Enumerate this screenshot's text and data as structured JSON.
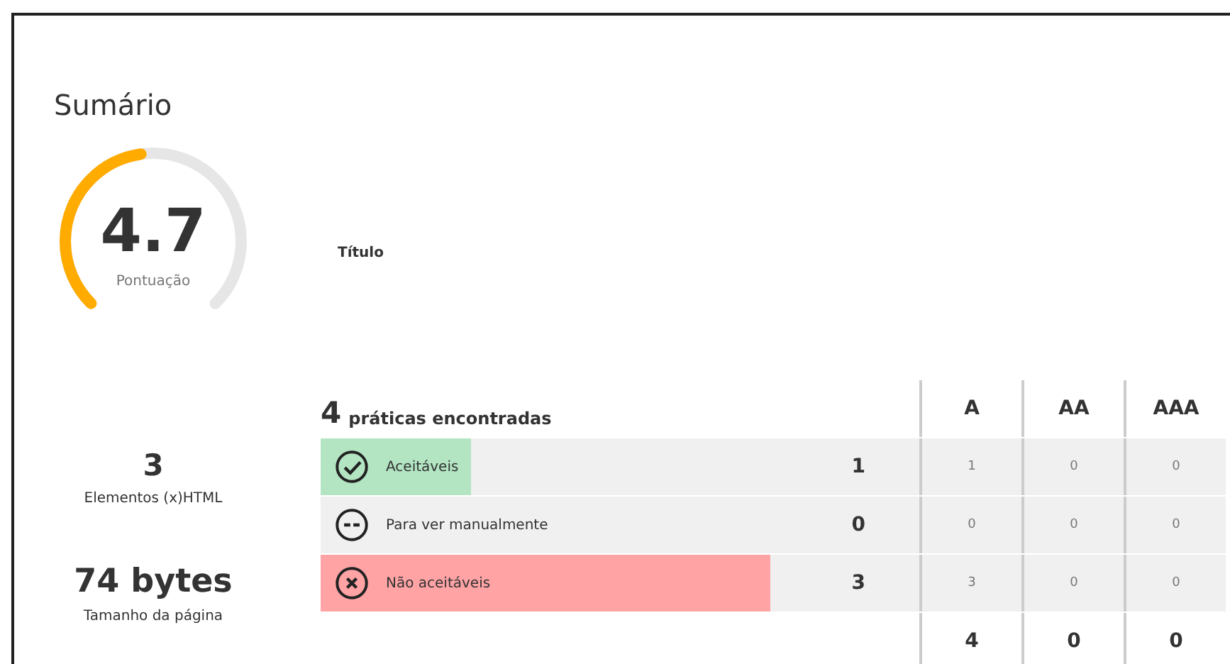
{
  "title": "Sumário",
  "score": {
    "value": "4.7",
    "label": "Pontuação",
    "level": 0.47
  },
  "page_title_label": "Título",
  "stats": [
    {
      "value": "3",
      "label": "Elementos (x)HTML"
    },
    {
      "value": "74 bytes",
      "label": "Tamanho da página"
    }
  ],
  "practices": {
    "count": "4",
    "heading": "práticas encontradas",
    "columns": [
      "A",
      "AA",
      "AAA"
    ],
    "rows": [
      {
        "kind": "pass",
        "label": "Aceitáveis",
        "level": 0.25,
        "total": "1",
        "cells": [
          "1",
          "0",
          "0"
        ]
      },
      {
        "kind": "manual",
        "label": "Para ver manualmente",
        "level": 0,
        "total": "0",
        "cells": [
          "0",
          "0",
          "0"
        ]
      },
      {
        "kind": "fail",
        "label": "Não aceitáveis",
        "level": 0.75,
        "total": "3",
        "cells": [
          "3",
          "0",
          "0"
        ]
      }
    ],
    "totals": [
      "4",
      "0",
      "0"
    ]
  }
}
